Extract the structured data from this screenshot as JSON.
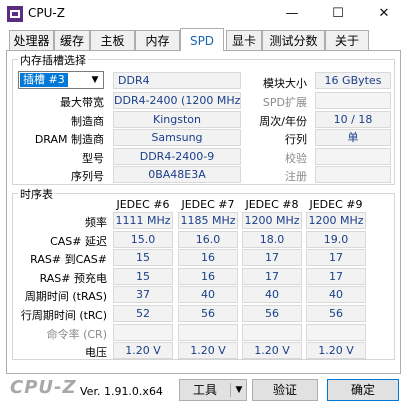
{
  "window": {
    "title": "CPU-Z",
    "minimize_glyph": "—",
    "maximize_glyph": "☐",
    "close_glyph": "✕"
  },
  "tabs": [
    {
      "label": "处理器"
    },
    {
      "label": "缓存"
    },
    {
      "label": "主板"
    },
    {
      "label": "内存"
    },
    {
      "label": "SPD"
    },
    {
      "label": "显卡"
    },
    {
      "label": "测试分数"
    },
    {
      "label": "关于"
    }
  ],
  "slot": {
    "group_title": "内存插槽选择",
    "selected_slot": "插槽 #3",
    "module_type": "DDR4",
    "labels": {
      "max_bandwidth": "最大带宽",
      "manufacturer": "制造商",
      "dram_manufacturer": "DRAM 制造商",
      "part_number": "型号",
      "serial_number": "序列号",
      "module_size": "模块大小",
      "spd_ext": "SPD扩展",
      "week_year": "周次/年份",
      "ranks": "行列",
      "correction": "校验",
      "registered": "注册"
    },
    "values": {
      "max_bandwidth": "DDR4-2400 (1200 MHz)",
      "manufacturer": "Kingston",
      "dram_manufacturer": "Samsung",
      "part_number": "DDR4-2400-9",
      "serial_number": "0BA48E3A",
      "module_size": "16 GBytes",
      "spd_ext": "",
      "week_year": "10 / 18",
      "ranks": "单",
      "correction": "",
      "registered": ""
    }
  },
  "timings": {
    "group_title": "时序表",
    "columns": [
      "JEDEC #6",
      "JEDEC #7",
      "JEDEC #8",
      "JEDEC #9"
    ],
    "rows": [
      {
        "label": "频率",
        "dim": false,
        "values": [
          "1111 MHz",
          "1185 MHz",
          "1200 MHz",
          "1200 MHz"
        ]
      },
      {
        "label": "CAS# 延迟",
        "dim": false,
        "values": [
          "15.0",
          "16.0",
          "18.0",
          "19.0"
        ]
      },
      {
        "label": "RAS# 到CAS#",
        "dim": false,
        "values": [
          "15",
          "16",
          "17",
          "17"
        ]
      },
      {
        "label": "RAS# 预充电",
        "dim": false,
        "values": [
          "15",
          "16",
          "17",
          "17"
        ]
      },
      {
        "label": "周期时间 (tRAS)",
        "dim": false,
        "values": [
          "37",
          "40",
          "40",
          "40"
        ]
      },
      {
        "label": "行周期时间 (tRC)",
        "dim": false,
        "values": [
          "52",
          "56",
          "56",
          "56"
        ]
      },
      {
        "label": "命令率 (CR)",
        "dim": true,
        "values": [
          "",
          "",
          "",
          ""
        ]
      },
      {
        "label": "电压",
        "dim": false,
        "values": [
          "1.20 V",
          "1.20 V",
          "1.20 V",
          "1.20 V"
        ]
      }
    ]
  },
  "footer": {
    "logo": "CPU-Z",
    "version": "Ver. 1.91.0.x64",
    "tools_label": "工具",
    "validate_label": "验证",
    "ok_label": "确定"
  }
}
